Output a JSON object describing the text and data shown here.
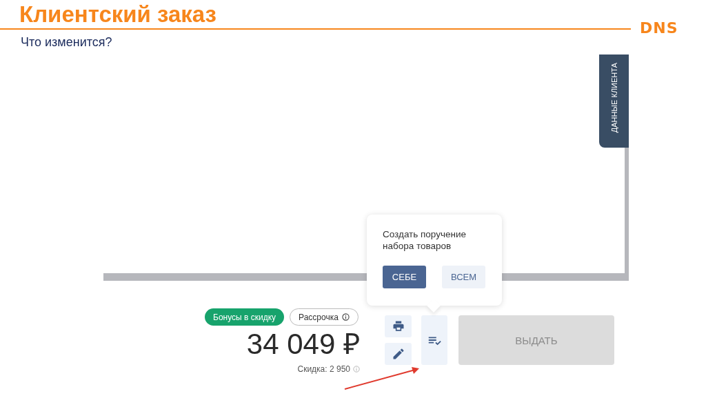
{
  "slide": {
    "title": "Клиентский заказ",
    "subtitle": "Что изменится?",
    "logo": "DNS"
  },
  "side_tab": {
    "label": "ДАННЫЕ КЛИЕНТА"
  },
  "chips": [
    {
      "label": "Бонусы в скидку",
      "kind": "filled",
      "info": false
    },
    {
      "label": "Рассрочка",
      "kind": "outlined",
      "info": true
    }
  ],
  "total": "34 049 ₽",
  "discount": {
    "text": "Скидка: 2 950",
    "info": true
  },
  "popover": {
    "text": "Создать поручение набора товаров",
    "buttons": [
      {
        "label": "СЕБЕ",
        "kind": "primary"
      },
      {
        "label": "ВСЕМ",
        "kind": "secondary"
      }
    ]
  },
  "issue_button": {
    "label": "ВЫДАТЬ",
    "disabled": true
  }
}
